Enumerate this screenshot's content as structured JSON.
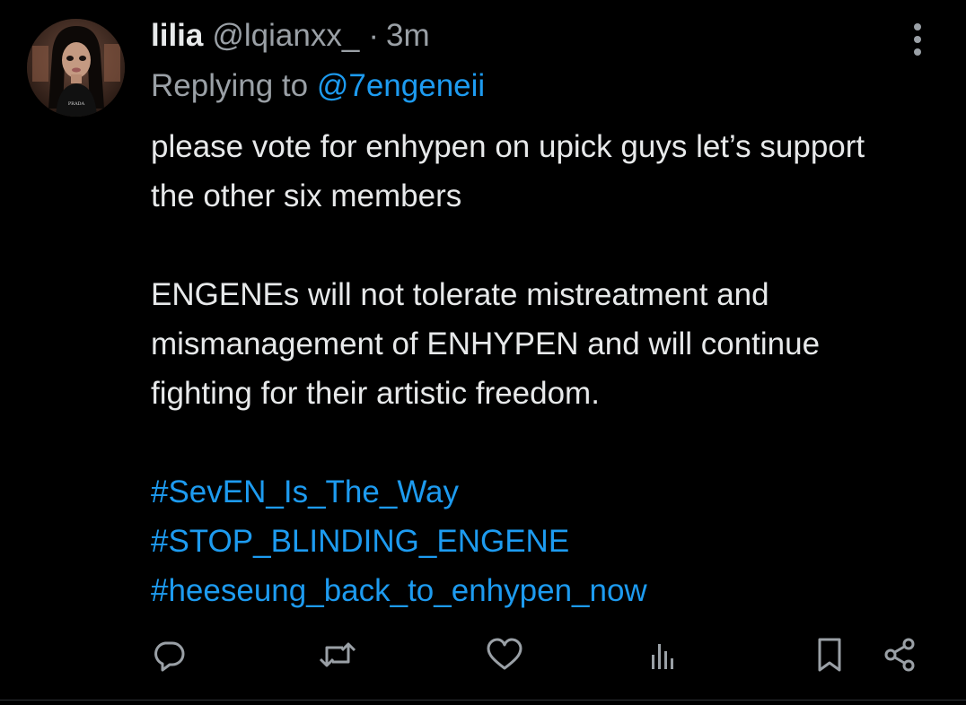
{
  "tweet": {
    "display_name": "lilia",
    "handle": "@lqianxx_",
    "separator": "·",
    "time": "3m",
    "replying_prefix": "Replying to",
    "replying_to": "@7engeneii",
    "body_lines": {
      "p1": "please vote for enhypen on upick guys let’s support the other six members",
      "p2": "ENGENEs will not tolerate mistreatment and mismanagement of ENHYPEN and will continue fighting for their artistic freedom."
    },
    "hashtags": [
      "#SevEN_Is_The_Way",
      "#STOP_BLINDING_ENGENE",
      "#heeseung_back_to_enhypen_now"
    ],
    "avatar_shirt_text": "PRADA"
  },
  "actions": {
    "icons": [
      "reply-icon",
      "retweet-icon",
      "like-icon",
      "views-icon",
      "bookmark-icon",
      "share-icon"
    ]
  },
  "colors": {
    "background": "#000000",
    "text": "#e7e9ea",
    "muted": "#9aa0a6",
    "accent": "#1d9bf0",
    "icon": "#9aa0a6"
  }
}
